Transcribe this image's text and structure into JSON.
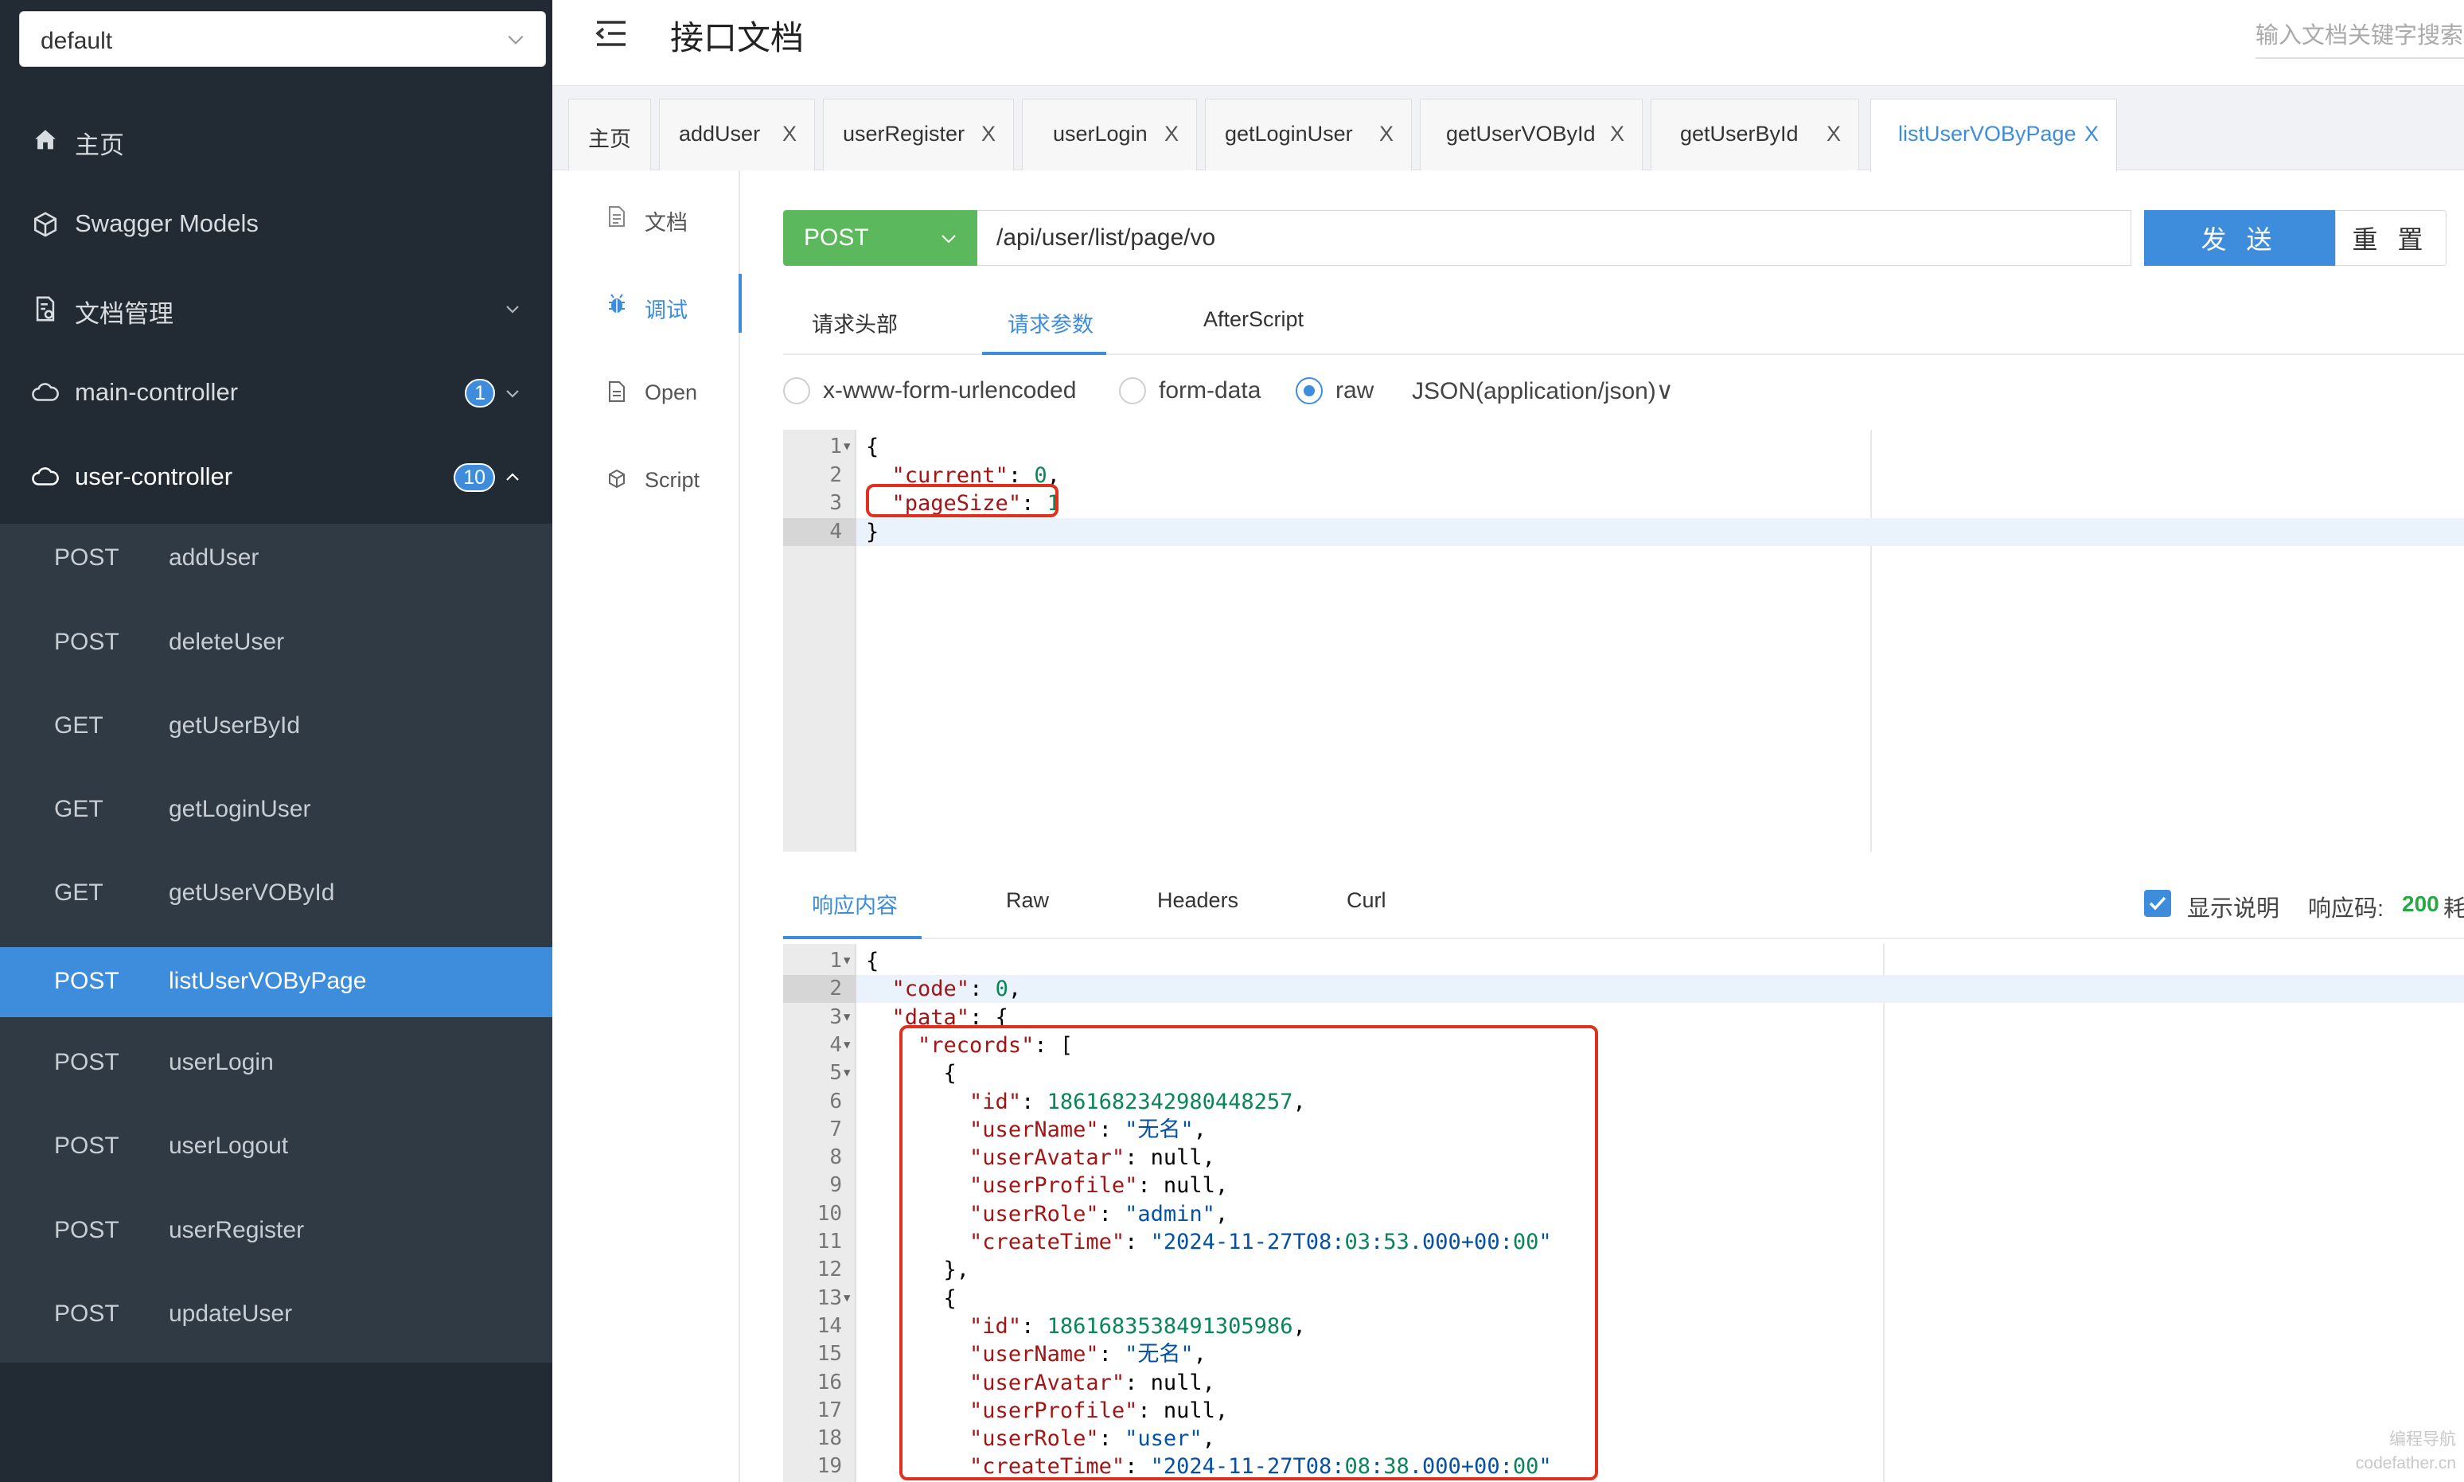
{
  "sidebar": {
    "group_select": "default",
    "nav": {
      "home": "主页",
      "swagger_models": "Swagger Models",
      "doc_manage": "文档管理",
      "main_controller": {
        "label": "main-controller",
        "count": "1"
      },
      "user_controller": {
        "label": "user-controller",
        "count": "10"
      }
    },
    "operations": [
      {
        "method": "POST",
        "name": "addUser"
      },
      {
        "method": "POST",
        "name": "deleteUser"
      },
      {
        "method": "GET",
        "name": "getUserById"
      },
      {
        "method": "GET",
        "name": "getLoginUser"
      },
      {
        "method": "GET",
        "name": "getUserVOById"
      },
      {
        "method": "POST",
        "name": "listUserVOByPage"
      },
      {
        "method": "POST",
        "name": "userLogin"
      },
      {
        "method": "POST",
        "name": "userLogout"
      },
      {
        "method": "POST",
        "name": "userRegister"
      },
      {
        "method": "POST",
        "name": "updateUser"
      }
    ]
  },
  "header": {
    "title": "接口文档",
    "search_placeholder": "输入文档关键字搜索"
  },
  "tabs": [
    "主页",
    "addUser",
    "userRegister",
    "userLogin",
    "getLoginUser",
    "getUserVOById",
    "getUserById",
    "listUserVOByPage"
  ],
  "tab_close": "X",
  "vmenu": {
    "doc": "文档",
    "debug": "调试",
    "open": "Open",
    "script": "Script"
  },
  "request": {
    "method": "POST",
    "url": "/api/user/list/page/vo",
    "send": "发 送",
    "reset": "重 置"
  },
  "req_tabs": [
    "请求头部",
    "请求参数",
    "AfterScript"
  ],
  "body_types": [
    "x-www-form-urlencoded",
    "form-data",
    "raw"
  ],
  "content_type": "JSON(application/json)∨",
  "request_body": [
    "{",
    "  \"current\": 0,",
    "  \"pageSize\": 1",
    "}"
  ],
  "resp_tabs": [
    "响应内容",
    "Raw",
    "Headers",
    "Curl"
  ],
  "show_desc": "显示说明",
  "status_label": "响应码:",
  "status_code": "200",
  "status_cut": "耗",
  "response_body": [
    "{",
    "  \"code\": 0,",
    "  \"data\": {",
    "    \"records\": [",
    "      {",
    "        \"id\": 1861682342980448257,",
    "        \"userName\": \"无名\",",
    "        \"userAvatar\": null,",
    "        \"userProfile\": null,",
    "        \"userRole\": \"admin\",",
    "        \"createTime\": \"2024-11-27T08:03:53.000+00:00\"",
    "      },",
    "      {",
    "        \"id\": 1861683538491305986,",
    "        \"userName\": \"无名\",",
    "        \"userAvatar\": null,",
    "        \"userProfile\": null,",
    "        \"userRole\": \"user\",",
    "        \"createTime\": \"2024-11-27T08:08:38.000+00:00\""
  ],
  "watermark": [
    "编程导航",
    "codefather.cn"
  ],
  "colors": {
    "accent": "#3e8ddc",
    "post": "#5cb85c",
    "sidebar": "#222b33",
    "highlight": "#e0311f"
  }
}
